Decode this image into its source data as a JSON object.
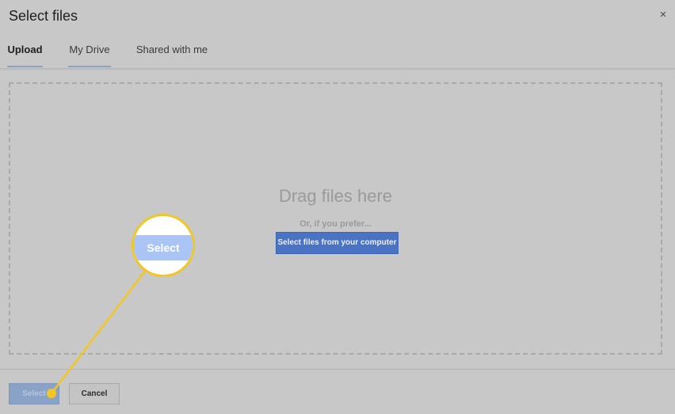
{
  "dialog": {
    "title": "Select files",
    "close_glyph": "×"
  },
  "tabs": [
    {
      "label": "Upload",
      "active": true
    },
    {
      "label": "My Drive",
      "active": false
    },
    {
      "label": "Shared with me",
      "active": false
    }
  ],
  "dropzone": {
    "heading": "Drag files here",
    "subtext": "Or, if you prefer...",
    "button_label": "Select files from your computer"
  },
  "footer": {
    "select_label": "Select",
    "cancel_label": "Cancel"
  },
  "callout": {
    "label": "Select",
    "color": "#f2c624"
  },
  "colors": {
    "accent_blue": "#4a74c3",
    "tab_underline": "#8aa2c4"
  },
  "icons": {
    "close": "close-icon"
  }
}
